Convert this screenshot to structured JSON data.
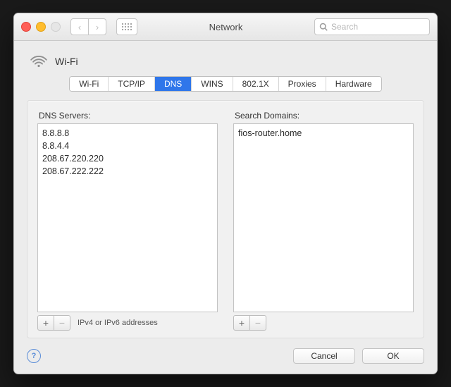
{
  "window": {
    "title": "Network"
  },
  "search": {
    "placeholder": "Search"
  },
  "heading": {
    "title": "Wi-Fi"
  },
  "tabs": [
    {
      "label": "Wi-Fi"
    },
    {
      "label": "TCP/IP"
    },
    {
      "label": "DNS"
    },
    {
      "label": "WINS"
    },
    {
      "label": "802.1X"
    },
    {
      "label": "Proxies"
    },
    {
      "label": "Hardware"
    }
  ],
  "active_tab_index": 2,
  "dns": {
    "label": "DNS Servers:",
    "servers": [
      "8.8.8.8",
      "8.8.4.4",
      "208.67.220.220",
      "208.67.222.222"
    ],
    "hint": "IPv4 or IPv6 addresses"
  },
  "search_domains": {
    "label": "Search Domains:",
    "domains": [
      "fios-router.home"
    ]
  },
  "buttons": {
    "plus": "+",
    "minus": "−",
    "help": "?",
    "cancel": "Cancel",
    "ok": "OK"
  }
}
